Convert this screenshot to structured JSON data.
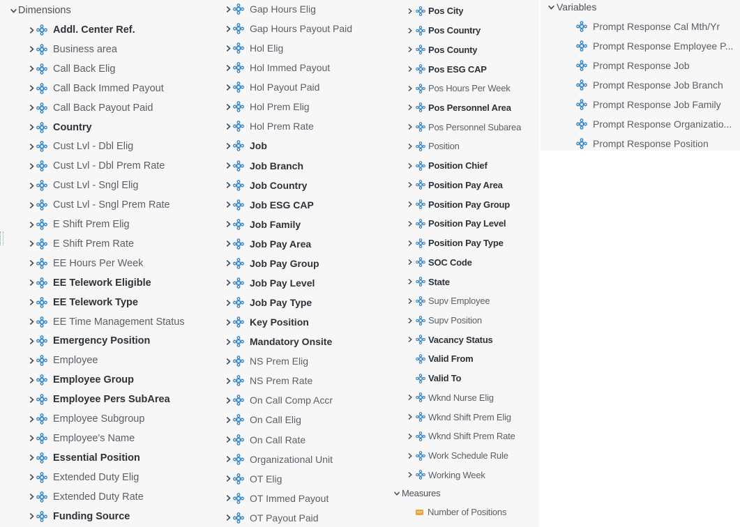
{
  "col1": {
    "section": "Dimensions",
    "items": [
      {
        "label": "Addl. Center Ref.",
        "bold": true
      },
      {
        "label": "Business area",
        "bold": false
      },
      {
        "label": "Call Back Elig",
        "bold": false
      },
      {
        "label": "Call Back Immed Payout",
        "bold": false
      },
      {
        "label": "Call Back Payout Paid",
        "bold": false
      },
      {
        "label": "Country",
        "bold": true
      },
      {
        "label": "Cust Lvl - Dbl Elig",
        "bold": false
      },
      {
        "label": "Cust Lvl - Dbl Prem Rate",
        "bold": false
      },
      {
        "label": "Cust Lvl - Sngl Elig",
        "bold": false
      },
      {
        "label": "Cust Lvl - Sngl Prem Rate",
        "bold": false
      },
      {
        "label": "E Shift Prem Elig",
        "bold": false
      },
      {
        "label": "E Shift Prem Rate",
        "bold": false
      },
      {
        "label": "EE Hours Per Week",
        "bold": false
      },
      {
        "label": "EE Telework Eligible",
        "bold": true
      },
      {
        "label": "EE Telework Type",
        "bold": true
      },
      {
        "label": "EE Time Management Status",
        "bold": false
      },
      {
        "label": "Emergency Position",
        "bold": true
      },
      {
        "label": "Employee",
        "bold": false
      },
      {
        "label": "Employee Group",
        "bold": true
      },
      {
        "label": "Employee Pers SubArea",
        "bold": true
      },
      {
        "label": "Employee Subgroup",
        "bold": false
      },
      {
        "label": "Employee's Name",
        "bold": false
      },
      {
        "label": "Essential Position",
        "bold": true
      },
      {
        "label": "Extended Duty Elig",
        "bold": false
      },
      {
        "label": "Extended Duty Rate",
        "bold": false
      },
      {
        "label": "Funding Source",
        "bold": true
      }
    ]
  },
  "col2": {
    "items": [
      {
        "label": "Gap Hours Elig",
        "bold": false
      },
      {
        "label": "Gap Hours Payout Paid",
        "bold": false
      },
      {
        "label": "Hol Elig",
        "bold": false
      },
      {
        "label": "Hol Immed Payout",
        "bold": false
      },
      {
        "label": "Hol Payout Paid",
        "bold": false
      },
      {
        "label": "Hol Prem Elig",
        "bold": false
      },
      {
        "label": "Hol Prem Rate",
        "bold": false
      },
      {
        "label": "Job",
        "bold": true
      },
      {
        "label": "Job Branch",
        "bold": true
      },
      {
        "label": "Job Country",
        "bold": true
      },
      {
        "label": "Job ESG CAP",
        "bold": true
      },
      {
        "label": "Job Family",
        "bold": true
      },
      {
        "label": "Job Pay Area",
        "bold": true
      },
      {
        "label": "Job Pay Group",
        "bold": true
      },
      {
        "label": "Job Pay Level",
        "bold": true
      },
      {
        "label": "Job Pay Type",
        "bold": true
      },
      {
        "label": "Key Position",
        "bold": true
      },
      {
        "label": "Mandatory Onsite",
        "bold": true
      },
      {
        "label": "NS Prem Elig",
        "bold": false
      },
      {
        "label": "NS Prem Rate",
        "bold": false
      },
      {
        "label": "On Call Comp Accr",
        "bold": false
      },
      {
        "label": "On Call Elig",
        "bold": false
      },
      {
        "label": "On Call Rate",
        "bold": false
      },
      {
        "label": "Organizational Unit",
        "bold": false
      },
      {
        "label": "OT Elig",
        "bold": false
      },
      {
        "label": "OT Immed Payout",
        "bold": false
      },
      {
        "label": "OT Payout Paid",
        "bold": false
      }
    ]
  },
  "col3": {
    "items": [
      {
        "label": "Pos City",
        "bold": true,
        "chevron": true
      },
      {
        "label": "Pos Country",
        "bold": true,
        "chevron": true
      },
      {
        "label": "Pos County",
        "bold": true,
        "chevron": true
      },
      {
        "label": "Pos ESG CAP",
        "bold": true,
        "chevron": true
      },
      {
        "label": "Pos Hours Per Week",
        "bold": false,
        "chevron": true
      },
      {
        "label": "Pos Personnel Area",
        "bold": true,
        "chevron": true
      },
      {
        "label": "Pos Personnel Subarea",
        "bold": false,
        "chevron": true
      },
      {
        "label": "Position",
        "bold": false,
        "chevron": true
      },
      {
        "label": "Position Chief",
        "bold": true,
        "chevron": true
      },
      {
        "label": "Position Pay Area",
        "bold": true,
        "chevron": true
      },
      {
        "label": "Position Pay Group",
        "bold": true,
        "chevron": true
      },
      {
        "label": "Position Pay Level",
        "bold": true,
        "chevron": true
      },
      {
        "label": "Position Pay Type",
        "bold": true,
        "chevron": true
      },
      {
        "label": "SOC Code",
        "bold": true,
        "chevron": true
      },
      {
        "label": "State",
        "bold": true,
        "chevron": true
      },
      {
        "label": "Supv Employee",
        "bold": false,
        "chevron": true
      },
      {
        "label": "Supv Position",
        "bold": false,
        "chevron": true
      },
      {
        "label": "Vacancy Status",
        "bold": true,
        "chevron": true
      },
      {
        "label": "Valid From",
        "bold": true,
        "chevron": false
      },
      {
        "label": "Valid To",
        "bold": true,
        "chevron": false
      },
      {
        "label": "Wknd Nurse Elig",
        "bold": false,
        "chevron": true
      },
      {
        "label": "Wknd Shift Prem Elig",
        "bold": false,
        "chevron": true
      },
      {
        "label": "Wknd Shift Prem Rate",
        "bold": false,
        "chevron": true
      },
      {
        "label": "Work Schedule Rule",
        "bold": false,
        "chevron": true
      },
      {
        "label": "Working Week",
        "bold": false,
        "chevron": true
      }
    ],
    "measures_section": "Measures",
    "measures": [
      {
        "label": "Number of Positions",
        "icon": "measure-icon"
      }
    ]
  },
  "col4": {
    "section": "Variables",
    "items": [
      {
        "label": "Prompt Response Cal Mth/Yr"
      },
      {
        "label": "Prompt Response Employee P..."
      },
      {
        "label": "Prompt Response Job"
      },
      {
        "label": "Prompt Response Job Branch"
      },
      {
        "label": "Prompt Response Job Family"
      },
      {
        "label": "Prompt Response Organizatio..."
      },
      {
        "label": "Prompt Response Position"
      }
    ]
  },
  "colors": {
    "panel": "#f7f7f7",
    "dimension_icon": "#2a7fc7",
    "text_bold": "#2c3238",
    "text_normal": "#5a6068",
    "measure_icon": "#f0a33a"
  },
  "icons": {
    "expand": "chevron-right-icon",
    "collapse": "chevron-down-icon",
    "dimension": "dimension-icon",
    "measure": "measure-icon"
  }
}
